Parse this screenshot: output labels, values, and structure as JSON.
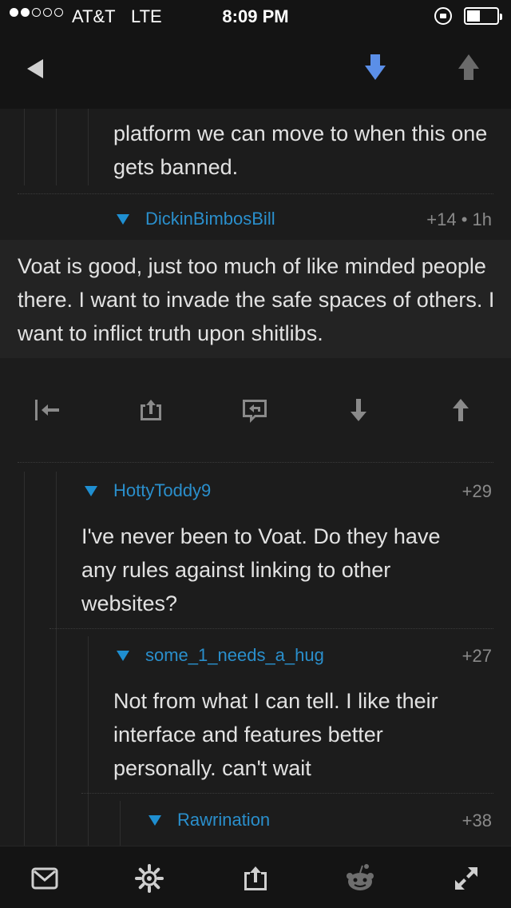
{
  "status": {
    "carrier": "AT&T",
    "network": "LTE",
    "time": "8:09 PM"
  },
  "nav": {
    "back_icon": "back-arrow-icon",
    "downvote_icon": "downvote-arrow-icon",
    "upvote_icon": "upvote-arrow-icon",
    "downvote_color": "#5b8fe8",
    "upvote_color": "#6a6a6a"
  },
  "comments": [
    {
      "text": "platform we can move to when this one gets banned."
    },
    {
      "author": "DickinBimbosBill",
      "score": "+14 • 1h",
      "text": "Voat is good, just too much of like minded people there. I want to invade the safe spaces of others. I want to inflict truth upon shitlibs."
    },
    {
      "author": "HottyToddy9",
      "score": "+29",
      "text": "I've never been to Voat. Do they have any rules against linking to other websites?"
    },
    {
      "author": "some_1_needs_a_hug",
      "score": "+27",
      "text": "Not from what I can tell.  I like their interface and features better personally.  can't wait"
    },
    {
      "author": "Rawrination",
      "score": "+38"
    }
  ],
  "actions": [
    "collapse-to-parent-icon",
    "share-icon",
    "reply-icon",
    "downvote-icon",
    "upvote-icon"
  ],
  "tabs": [
    "mail-icon",
    "settings-gear-icon",
    "share-icon",
    "reddit-alien-icon",
    "expand-icon"
  ],
  "colors": {
    "accent": "#2a8fcc",
    "background": "#1c1c1c",
    "bar": "#141414"
  }
}
